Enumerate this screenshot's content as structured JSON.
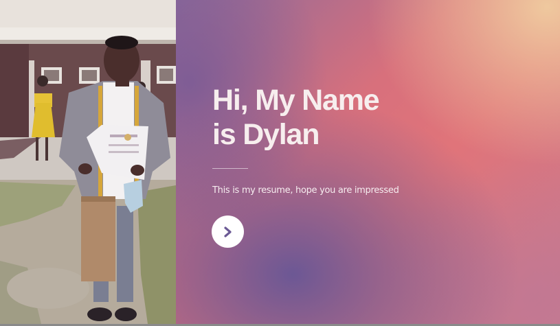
{
  "hero": {
    "title_line1": "Hi, My Name",
    "title_line2": "is Dylan",
    "subtitle": "This is my resume, hope you are impressed",
    "next_button_icon": "chevron-right-icon"
  },
  "photo": {
    "alt": "Dylan holding a certificate"
  },
  "colors": {
    "title": "#f7eeee",
    "button_bg": "#ffffff",
    "button_icon": "#6b5a95",
    "gradient_purple": "#665696",
    "gradient_coral": "#e0747a",
    "gradient_peach": "#f0cda0"
  }
}
